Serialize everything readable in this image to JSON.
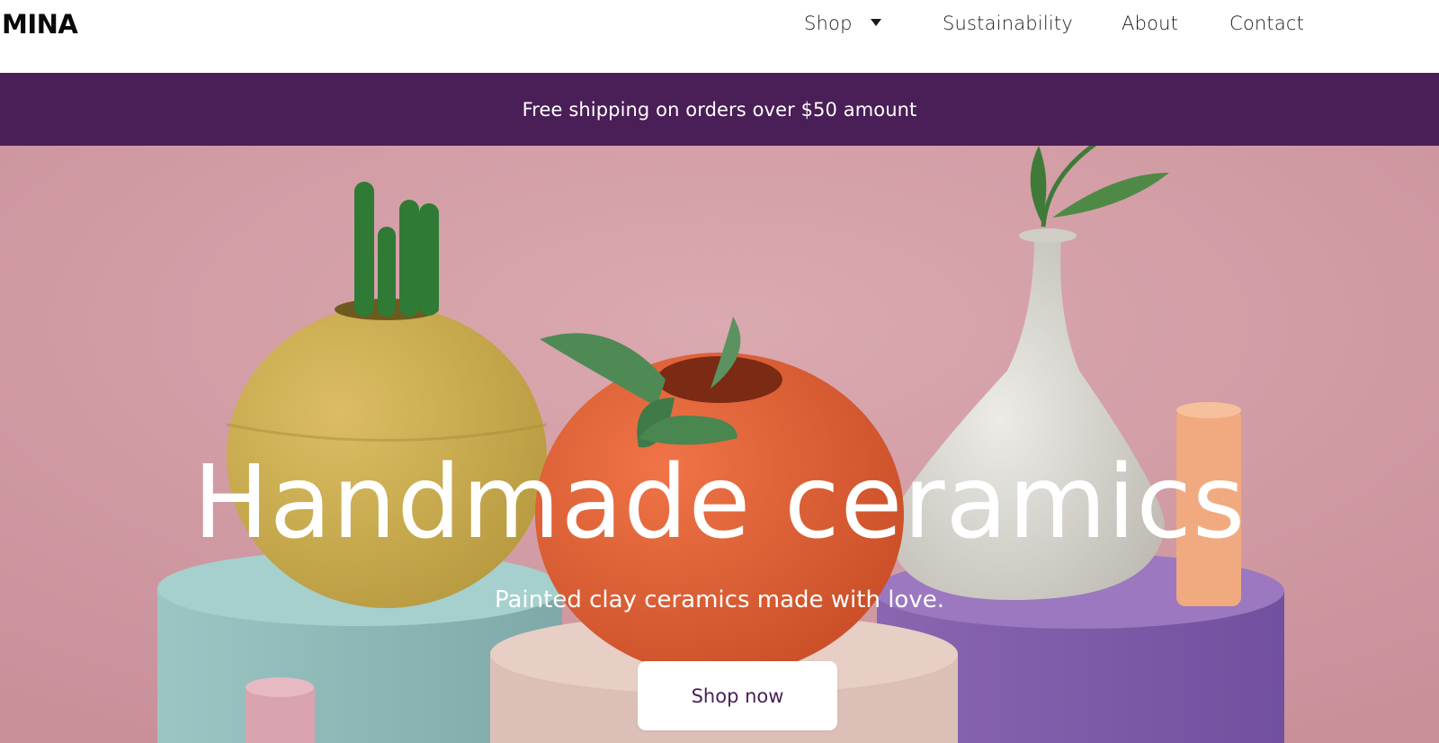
{
  "header": {
    "logo": "MINA",
    "nav": [
      {
        "label": "Shop",
        "has_dropdown": true
      },
      {
        "label": "Sustainability"
      },
      {
        "label": "About"
      },
      {
        "label": "Contact"
      }
    ]
  },
  "banner": {
    "text": "Free shipping on orders over $50 amount",
    "background": "#4a1e57"
  },
  "hero": {
    "title": "Handmade ceramics",
    "subtitle": "Painted clay ceramics made with love.",
    "cta_label": "Shop now",
    "cta_color": "#4a1e57"
  },
  "icons": {
    "dropdown": "chevron-down-icon"
  }
}
